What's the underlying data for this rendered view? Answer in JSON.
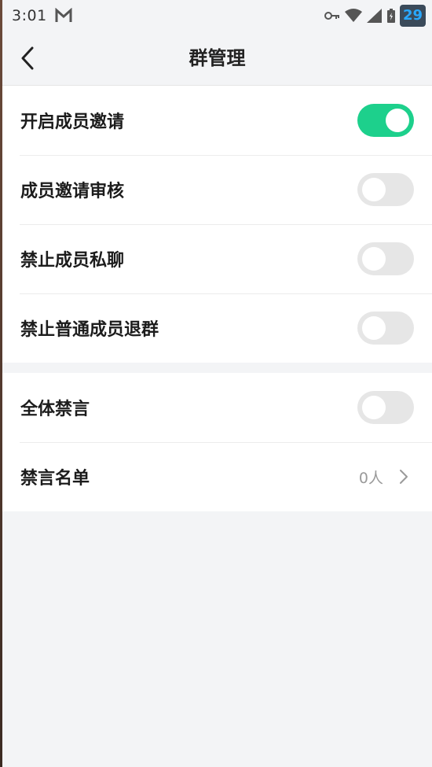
{
  "status_bar": {
    "time": "3:01",
    "notification_badge": "29"
  },
  "nav": {
    "title": "群管理"
  },
  "settings_group_1": [
    {
      "label": "开启成员邀请",
      "enabled": true
    },
    {
      "label": "成员邀请审核",
      "enabled": false
    },
    {
      "label": "禁止成员私聊",
      "enabled": false
    },
    {
      "label": "禁止普通成员退群",
      "enabled": false
    }
  ],
  "settings_group_2": {
    "mute_all": {
      "label": "全体禁言",
      "enabled": false
    },
    "mute_list": {
      "label": "禁言名单",
      "value": "0人"
    }
  },
  "colors": {
    "toggle_on": "#1dd08c",
    "toggle_off": "#e6e6e6",
    "background": "#f3f4f6",
    "badge_text": "#29a8ff"
  },
  "icons": [
    "gmail-icon",
    "key-icon",
    "wifi-icon",
    "cell-signal-icon",
    "battery-icon",
    "back-arrow-icon",
    "chevron-right-icon"
  ]
}
